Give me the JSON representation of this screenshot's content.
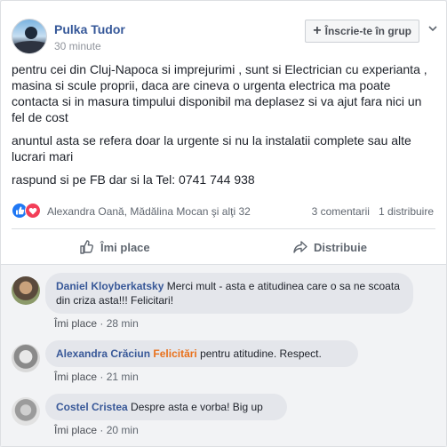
{
  "post": {
    "author": "Pulka Tudor",
    "time": "30 minute",
    "join_label": "Înscrie-te în grup",
    "paragraphs": [
      "pentru cei din Cluj-Napoca si imprejurimi , sunt si Electrician cu experianta , masina si scule proprii, daca are cineva o urgenta electrica ma poate contacta si in masura timpului disponibil ma deplasez si va ajut fara nici un fel de cost",
      "anuntul asta se refera doar la urgente si nu la instalatii complete sau alte lucrari mari",
      "raspund si pe FB dar si la Tel: 0741 744 938"
    ],
    "reactions_names": "Alexandra Oană, Mădălina Mocan şi alţi 32",
    "reactions_counts": "3 comentarii   1 distribuire",
    "like_label": "Îmi place",
    "share_label": "Distribuie",
    "colors": {
      "link": "#365899",
      "like_blue": "#2078f4",
      "love_red": "#f33e58"
    }
  },
  "comments": [
    {
      "name": "Daniel Kloyberkatsky",
      "text": "Merci mult - asta e atitudinea care o sa ne scoata din criza asta!!! Felicitari!",
      "like": "Îmi place",
      "sep": "·",
      "time": "28 min"
    },
    {
      "name": "Alexandra Crăciun",
      "emph": "Felicitări",
      "text": " pentru atitudine. Respect.",
      "like": "Îmi place",
      "sep": "·",
      "time": "21 min"
    },
    {
      "name": "Costel Cristea",
      "text": "Despre asta e vorba! Big up",
      "like": "Îmi place",
      "sep": "·",
      "time": "20 min"
    }
  ]
}
